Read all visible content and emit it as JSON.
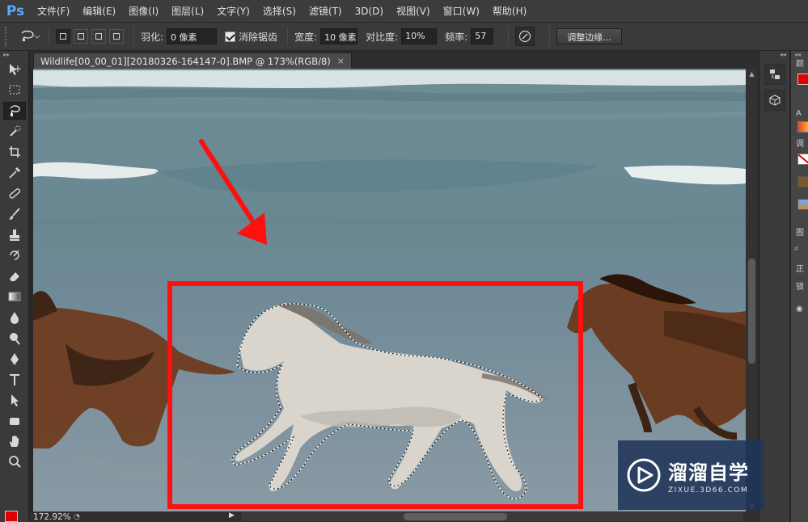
{
  "app": {
    "logo": "Ps"
  },
  "menu": [
    "文件(F)",
    "编辑(E)",
    "图像(I)",
    "图层(L)",
    "文字(Y)",
    "选择(S)",
    "滤镜(T)",
    "3D(D)",
    "视图(V)",
    "窗口(W)",
    "帮助(H)"
  ],
  "options": {
    "feather_label": "羽化:",
    "feather_value": "0 像素",
    "antialias_label": "消除锯齿",
    "antialias_checked": true,
    "width_label": "宽度:",
    "width_value": "10 像素",
    "contrast_label": "对比度:",
    "contrast_value": "10%",
    "frequency_label": "频率:",
    "frequency_value": "57",
    "refine_edge_label": "调整边缘..."
  },
  "document": {
    "tab_title": "Wildlife[00_00_01][20180326-164147-0].BMP @ 173%(RGB/8)",
    "close_glyph": "×"
  },
  "status": {
    "zoom": "172.92%"
  },
  "colors": {
    "foreground": "#e00000",
    "annotation_red": "#ff1010",
    "accent_blue": "#5aa8ff"
  },
  "tools": [
    "move-icon",
    "marquee-icon",
    "magnetic-lasso-icon",
    "quick-select-icon",
    "crop-icon",
    "eyedropper-icon",
    "healing-icon",
    "brush-icon",
    "stamp-icon",
    "history-brush-icon",
    "eraser-icon",
    "gradient-icon",
    "blur-icon",
    "dodge-icon",
    "pen-icon",
    "type-icon",
    "path-select-icon",
    "shape-icon",
    "hand-icon",
    "zoom-icon"
  ],
  "right_panel": {
    "labels": [
      "颜",
      "调",
      "图",
      "正",
      "锁"
    ]
  },
  "watermark": {
    "title": "溜溜自学",
    "url": "ZIXUE.3D66.COM"
  }
}
